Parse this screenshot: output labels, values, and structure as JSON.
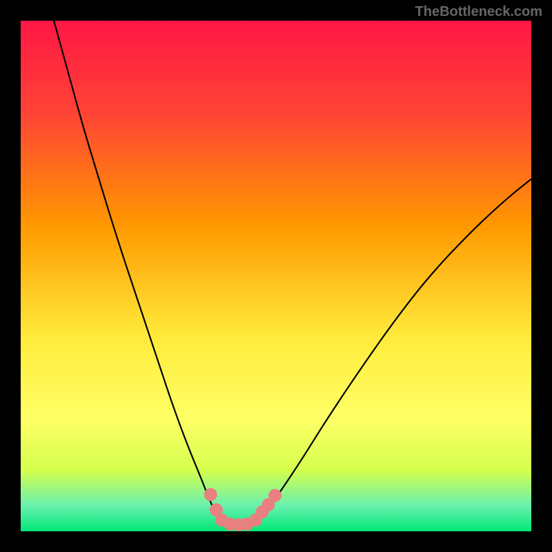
{
  "watermark": "TheBottleneck.com",
  "chart_data": {
    "type": "line",
    "title": "",
    "xlabel": "",
    "ylabel": "",
    "xlim": [
      0,
      100
    ],
    "ylim": [
      0,
      100
    ],
    "gradient_stops": [
      {
        "offset": 0,
        "color": "#ff1744"
      },
      {
        "offset": 18,
        "color": "#ff4336"
      },
      {
        "offset": 40,
        "color": "#ff9800"
      },
      {
        "offset": 62,
        "color": "#ffeb3b"
      },
      {
        "offset": 78,
        "color": "#ffff66"
      },
      {
        "offset": 88,
        "color": "#d4ff4d"
      },
      {
        "offset": 95,
        "color": "#69f0ae"
      },
      {
        "offset": 100,
        "color": "#00e676"
      }
    ],
    "series": [
      {
        "name": "curve",
        "color": "#000000",
        "points": [
          {
            "x": 6.5,
            "y": 100
          },
          {
            "x": 9,
            "y": 91
          },
          {
            "x": 12,
            "y": 80
          },
          {
            "x": 15,
            "y": 70
          },
          {
            "x": 19,
            "y": 57
          },
          {
            "x": 23,
            "y": 45
          },
          {
            "x": 27,
            "y": 33
          },
          {
            "x": 30,
            "y": 24
          },
          {
            "x": 33,
            "y": 16
          },
          {
            "x": 35.5,
            "y": 10
          },
          {
            "x": 37,
            "y": 6
          },
          {
            "x": 38.8,
            "y": 2.5
          },
          {
            "x": 40.5,
            "y": 1.2
          },
          {
            "x": 42.5,
            "y": 1.0
          },
          {
            "x": 44.5,
            "y": 1.2
          },
          {
            "x": 46.5,
            "y": 2.2
          },
          {
            "x": 48.5,
            "y": 4.5
          },
          {
            "x": 51,
            "y": 8
          },
          {
            "x": 55,
            "y": 14
          },
          {
            "x": 60,
            "y": 22
          },
          {
            "x": 66,
            "y": 31
          },
          {
            "x": 73,
            "y": 41
          },
          {
            "x": 80,
            "y": 50
          },
          {
            "x": 88,
            "y": 58.5
          },
          {
            "x": 95,
            "y": 65
          },
          {
            "x": 100,
            "y": 69
          }
        ]
      },
      {
        "name": "markers",
        "color": "#e88080",
        "points": [
          {
            "x": 37.2,
            "y": 7.2
          },
          {
            "x": 38.3,
            "y": 4.2
          },
          {
            "x": 39.4,
            "y": 2.2
          },
          {
            "x": 41.0,
            "y": 1.4
          },
          {
            "x": 42.7,
            "y": 1.3
          },
          {
            "x": 44.3,
            "y": 1.4
          },
          {
            "x": 46.0,
            "y": 2.2
          },
          {
            "x": 47.3,
            "y": 3.8
          },
          {
            "x": 48.5,
            "y": 5.2
          },
          {
            "x": 49.8,
            "y": 7.0
          }
        ]
      }
    ]
  }
}
